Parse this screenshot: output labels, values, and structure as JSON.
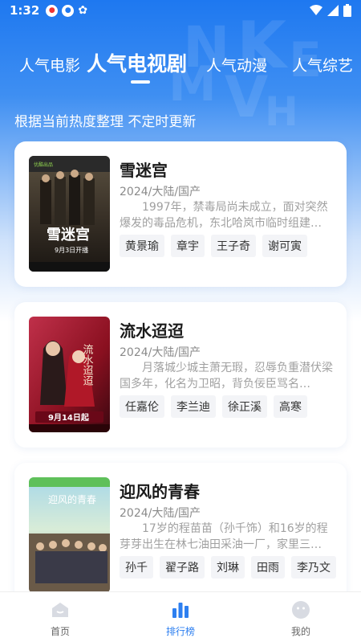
{
  "status_bar": {
    "time": "1:32"
  },
  "tabs": [
    {
      "label": "人气电影"
    },
    {
      "label": "人气电视剧"
    },
    {
      "label": "人气动漫"
    },
    {
      "label": "人气综艺"
    }
  ],
  "subtitle": "根据当前热度整理 不定时更新",
  "cards": [
    {
      "title": "雪迷宫",
      "meta": "2024/大陆/国产",
      "desc": "1997年，禁毒局尚未成立，面对突然爆发的毒品危机，东北哈岚市临时组建…",
      "actors": [
        "黄景瑜",
        "章宇",
        "王子奇",
        "谢可寅"
      ],
      "poster_texts": {
        "brand": "优酷出品",
        "title": "雪迷宫",
        "date": "9月3日开播"
      }
    },
    {
      "title": "流水迢迢",
      "meta": "2024/大陆/国产",
      "desc": "月落城少城主萧无瑕，忍辱负重潜伏梁国多年，化名为卫昭，背负佞臣骂名…",
      "actors": [
        "任嘉伦",
        "李兰迪",
        "徐正溪",
        "高寒"
      ],
      "poster_texts": {
        "title": "流水迢迢",
        "date": "9月14日起"
      }
    },
    {
      "title": "迎风的青春",
      "meta": "2024/大陆/国产",
      "desc": "17岁的程苗苗（孙千饰）和16岁的程芽芽出生在林七油田采油一厂，家里三…",
      "actors": [
        "孙千",
        "翟子路",
        "刘琳",
        "田雨",
        "李乃文"
      ],
      "poster_texts": {
        "title": "迎风的青春"
      }
    }
  ],
  "bottom_nav": [
    {
      "label": "首页",
      "icon": "home-icon"
    },
    {
      "label": "排行榜",
      "icon": "ranking-icon"
    },
    {
      "label": "我的",
      "icon": "profile-icon"
    }
  ],
  "colors": {
    "primary": "#2d7ff0",
    "header_gradient_top": "#1e78f0"
  }
}
